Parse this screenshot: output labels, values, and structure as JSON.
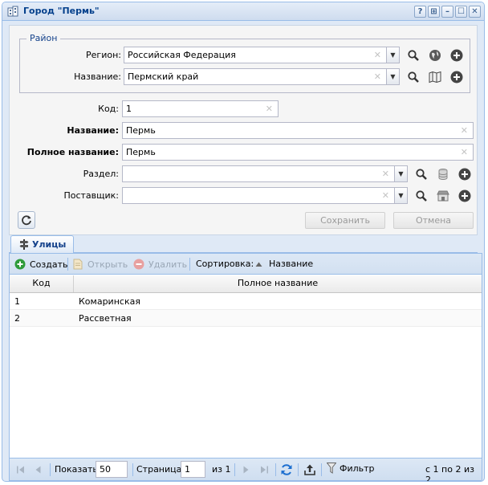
{
  "window": {
    "title": "Город \"Пермь\"",
    "tools": [
      "?",
      "⊞",
      "–",
      "☐",
      "✕"
    ]
  },
  "rayon": {
    "legend": "Район",
    "region_label": "Регион:",
    "region_value": "Российская Федерация",
    "name_label": "Название:",
    "name_value": "Пермский край"
  },
  "fields": {
    "code_label": "Код:",
    "code_value": "1",
    "name_label": "Название:",
    "name_value": "Пермь",
    "fullname_label": "Полное название:",
    "fullname_value": "Пермь",
    "section_label": "Раздел:",
    "section_value": "",
    "supplier_label": "Поставщик:",
    "supplier_value": ""
  },
  "buttons": {
    "save": "Сохранить",
    "cancel": "Отмена"
  },
  "tabs": [
    {
      "label": "Улицы"
    }
  ],
  "toolbar": {
    "create": "Создать",
    "open": "Открыть",
    "delete": "Удалить",
    "sort_label": "Сортировка:",
    "sort_field": "Название"
  },
  "columns": [
    "Код",
    "Полное название"
  ],
  "rows": [
    {
      "code": "1",
      "name": "Комаринская"
    },
    {
      "code": "2",
      "name": "Рассветная"
    }
  ],
  "pager": {
    "show_label": "Показать",
    "page_size": "50",
    "page_label": "Страница",
    "page": "1",
    "of_label": "из 1",
    "filter": "Фильтр",
    "summary": "с 1 по 2 из 2"
  },
  "colors": {
    "accent": "#15428b",
    "border": "#99bce8",
    "panel": "#dfe9f6"
  }
}
